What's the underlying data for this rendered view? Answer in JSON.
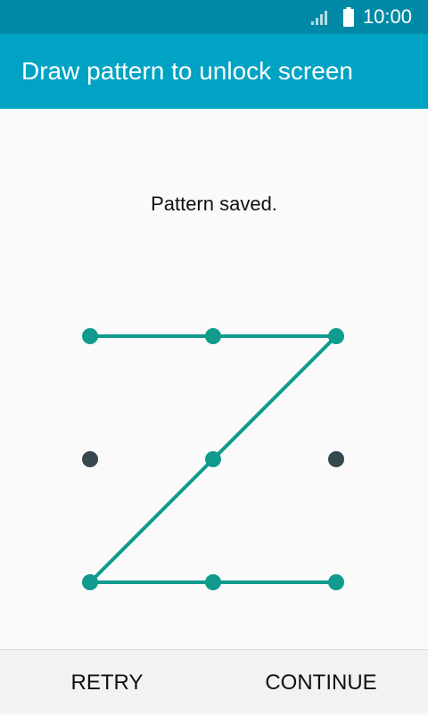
{
  "status_bar": {
    "time": "10:00",
    "icons": [
      "signal-icon",
      "battery-icon"
    ]
  },
  "app_bar": {
    "title": "Draw pattern to unlock screen"
  },
  "pattern": {
    "message": "Pattern saved.",
    "grid_size": 3,
    "selected_nodes": [
      1,
      2,
      3,
      5,
      7,
      8,
      9
    ],
    "path_order": [
      1,
      2,
      3,
      5,
      7,
      8,
      9
    ],
    "colors": {
      "selected": "#0f9b8e",
      "unselected": "#37474f",
      "line": "#0f9b8e"
    }
  },
  "actions": {
    "retry_label": "RETRY",
    "continue_label": "CONTINUE"
  }
}
